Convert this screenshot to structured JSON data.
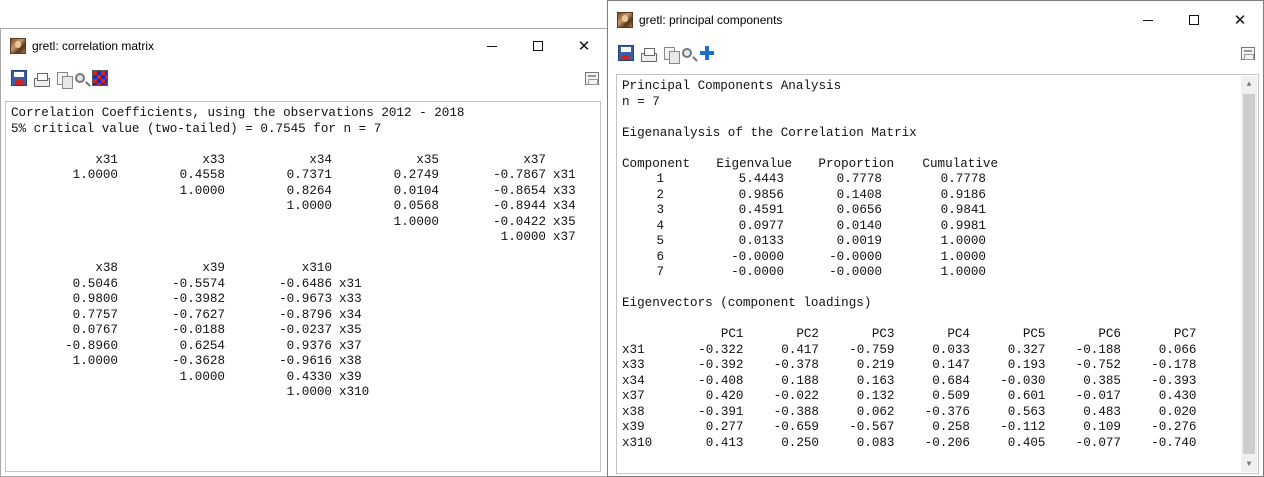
{
  "left_window": {
    "title": "gretl: correlation matrix",
    "controls": {
      "minimize": "",
      "maximize": "",
      "close": "✕"
    },
    "header_lines": [
      "Correlation Coefficients, using the observations 2012 - 2018",
      "5% critical value (two-tailed) = 0.7545 for n = 7"
    ],
    "block1": {
      "columns": [
        "x31",
        "x33",
        "x34",
        "x35",
        "x37"
      ],
      "rows": [
        {
          "cells": [
            "1.0000",
            "0.4558",
            "0.7371",
            "0.2749",
            "-0.7867"
          ],
          "label": "x31"
        },
        {
          "cells": [
            "",
            "1.0000",
            "0.8264",
            "0.0104",
            "-0.8654"
          ],
          "label": "x33"
        },
        {
          "cells": [
            "",
            "",
            "1.0000",
            "0.0568",
            "-0.8944"
          ],
          "label": "x34"
        },
        {
          "cells": [
            "",
            "",
            "",
            "1.0000",
            "-0.0422"
          ],
          "label": "x35"
        },
        {
          "cells": [
            "",
            "",
            "",
            "",
            "1.0000"
          ],
          "label": "x37"
        }
      ]
    },
    "block2": {
      "columns": [
        "x38",
        "x39",
        "x310"
      ],
      "rows": [
        {
          "cells": [
            "0.5046",
            "-0.5574",
            "-0.6486"
          ],
          "label": "x31"
        },
        {
          "cells": [
            "0.9800",
            "-0.3982",
            "-0.9673"
          ],
          "label": "x33"
        },
        {
          "cells": [
            "0.7757",
            "-0.7627",
            "-0.8796"
          ],
          "label": "x34"
        },
        {
          "cells": [
            "0.0767",
            "-0.0188",
            "-0.0237"
          ],
          "label": "x35"
        },
        {
          "cells": [
            "-0.8960",
            "0.6254",
            "0.9376"
          ],
          "label": "x37"
        },
        {
          "cells": [
            "1.0000",
            "-0.3628",
            "-0.9616"
          ],
          "label": "x38"
        },
        {
          "cells": [
            "",
            "1.0000",
            "0.4330"
          ],
          "label": "x39"
        },
        {
          "cells": [
            "",
            "",
            "1.0000"
          ],
          "label": "x310"
        }
      ]
    }
  },
  "right_window": {
    "title": "gretl: principal components",
    "controls": {
      "minimize": "",
      "maximize": "",
      "close": "✕"
    },
    "heading": "Principal Components Analysis",
    "n_line": "n = 7",
    "eigen_title": "Eigenanalysis of the Correlation Matrix",
    "eigen_headers": [
      "Component",
      "Eigenvalue",
      "Proportion",
      "Cumulative"
    ],
    "eigen_rows": [
      [
        "1",
        "5.4443",
        "0.7778",
        "0.7778"
      ],
      [
        "2",
        "0.9856",
        "0.1408",
        "0.9186"
      ],
      [
        "3",
        "0.4591",
        "0.0656",
        "0.9841"
      ],
      [
        "4",
        "0.0977",
        "0.0140",
        "0.9981"
      ],
      [
        "5",
        "0.0133",
        "0.0019",
        "1.0000"
      ],
      [
        "6",
        "-0.0000",
        "-0.0000",
        "1.0000"
      ],
      [
        "7",
        "-0.0000",
        "-0.0000",
        "1.0000"
      ]
    ],
    "vectors_title": "Eigenvectors (component loadings)",
    "vector_headers": [
      "PC1",
      "PC2",
      "PC3",
      "PC4",
      "PC5",
      "PC6",
      "PC7"
    ],
    "vector_rows": [
      {
        "label": "x31",
        "values": [
          "-0.322",
          "0.417",
          "-0.759",
          "0.033",
          "0.327",
          "-0.188",
          "0.066"
        ]
      },
      {
        "label": "x33",
        "values": [
          "-0.392",
          "-0.378",
          "0.219",
          "0.147",
          "0.193",
          "-0.752",
          "-0.178"
        ]
      },
      {
        "label": "x34",
        "values": [
          "-0.408",
          "0.188",
          "0.163",
          "0.684",
          "-0.030",
          "0.385",
          "-0.393"
        ]
      },
      {
        "label": "x37",
        "values": [
          "0.420",
          "-0.022",
          "0.132",
          "0.509",
          "0.601",
          "-0.017",
          "0.430"
        ]
      },
      {
        "label": "x38",
        "values": [
          "-0.391",
          "-0.388",
          "0.062",
          "-0.376",
          "0.563",
          "0.483",
          "0.020"
        ]
      },
      {
        "label": "x39",
        "values": [
          "0.277",
          "-0.659",
          "-0.567",
          "0.258",
          "-0.112",
          "0.109",
          "-0.276"
        ]
      },
      {
        "label": "x310",
        "values": [
          "0.413",
          "0.250",
          "0.083",
          "-0.206",
          "0.405",
          "-0.077",
          "-0.740"
        ]
      }
    ]
  }
}
